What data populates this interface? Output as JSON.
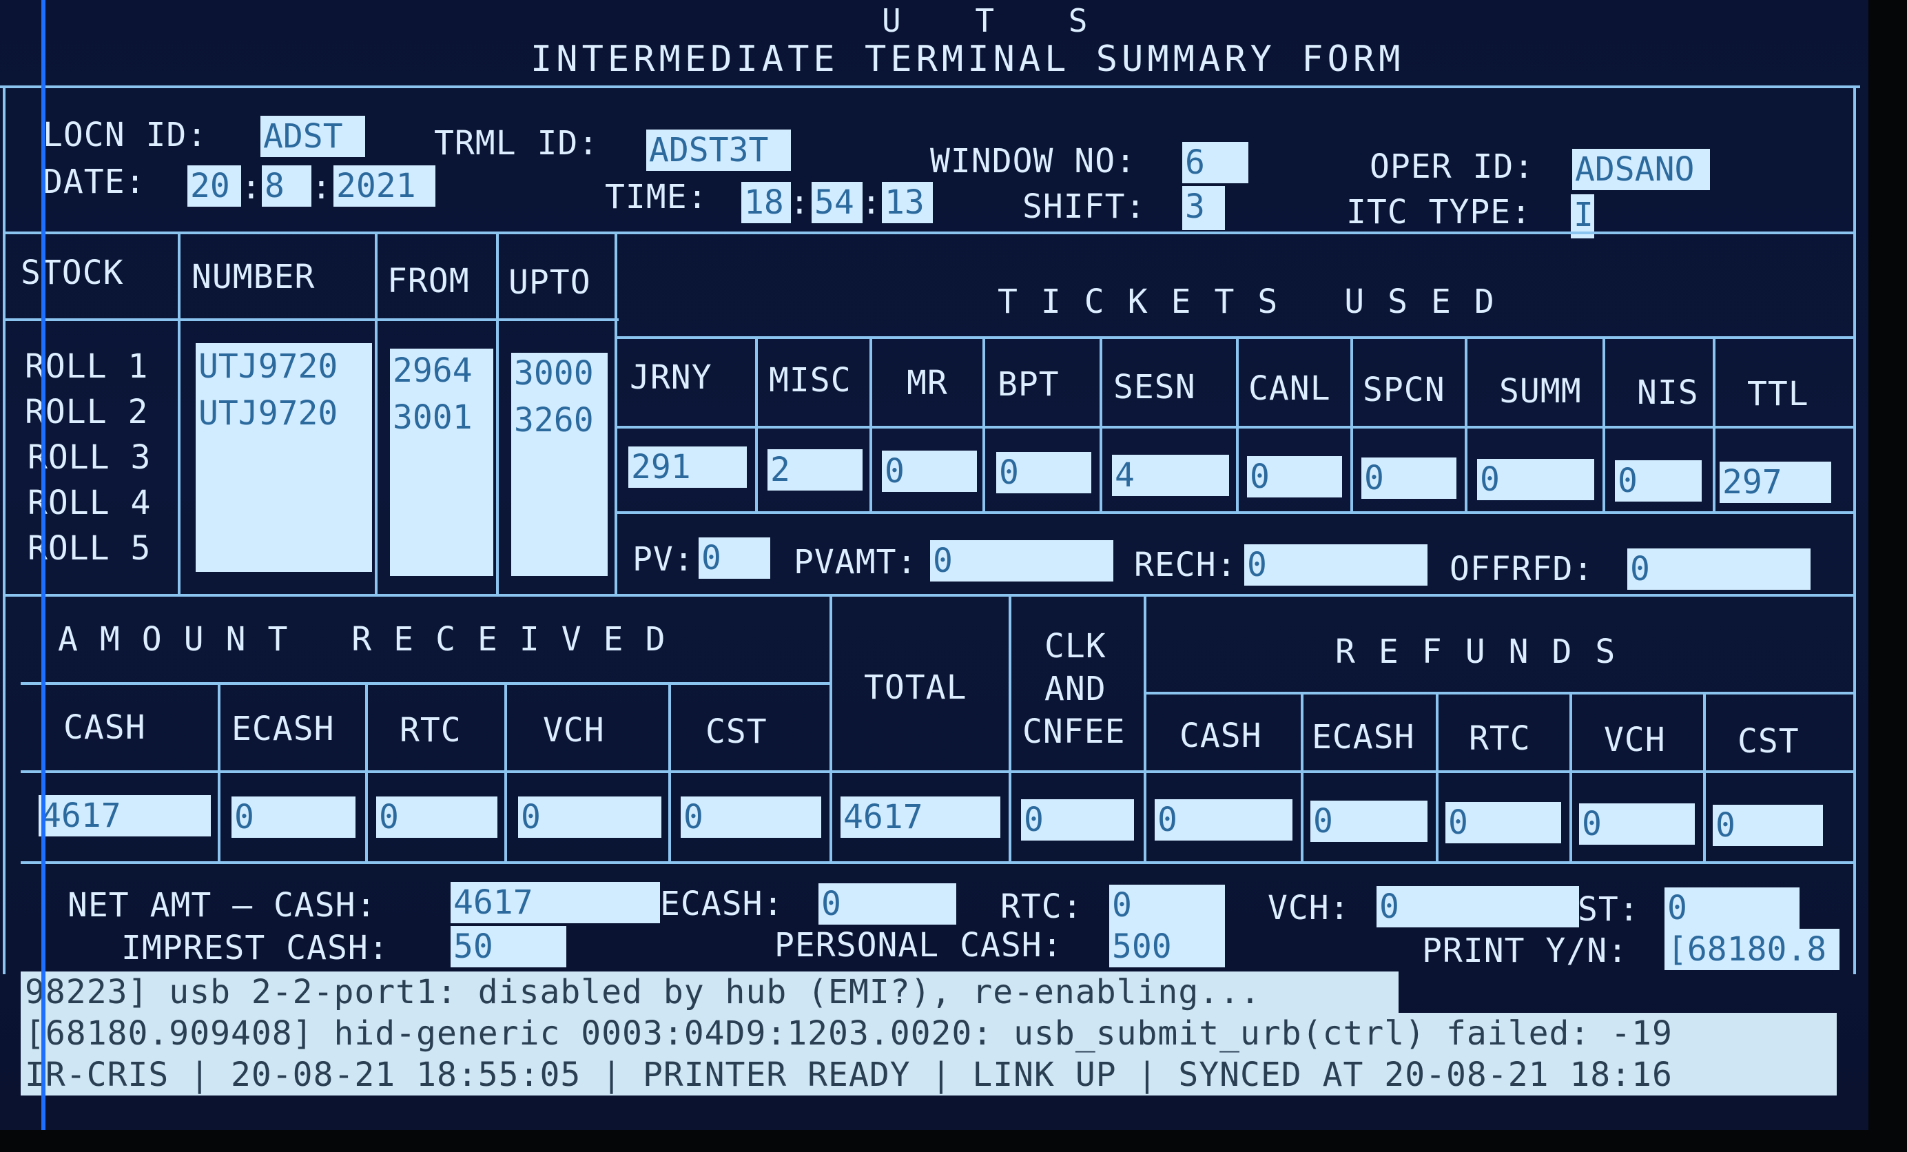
{
  "header": {
    "system": "U T S",
    "title": "INTERMEDIATE TERMINAL SUMMARY FORM"
  },
  "info": {
    "locn_label": "LOCN ID:",
    "locn_value": "ADST",
    "trml_label": "TRML ID:",
    "trml_value": "ADST3T",
    "window_label": "WINDOW NO:",
    "window_value": "6",
    "oper_label": "OPER ID:",
    "oper_value": "ADSANO",
    "date_label": "DATE:",
    "date_day": "20",
    "date_month": "8",
    "date_year": "2021",
    "date_sep": ":",
    "time_label": "TIME:",
    "time_h": "18",
    "time_m": "54",
    "time_s": "13",
    "shift_label": "SHIFT:",
    "shift_value": "3",
    "itc_label": "ITC TYPE:",
    "itc_value": "I"
  },
  "stock": {
    "headers": [
      "STOCK",
      "NUMBER",
      "FROM",
      "UPTO"
    ],
    "rolls": [
      {
        "label": "ROLL 1",
        "number": "UTJ9720",
        "from": "2964",
        "upto": "3000"
      },
      {
        "label": "ROLL 2",
        "number": "UTJ9720",
        "from": "3001",
        "upto": "3260"
      },
      {
        "label": "ROLL 3",
        "number": "",
        "from": "",
        "upto": ""
      },
      {
        "label": "ROLL 4",
        "number": "",
        "from": "",
        "upto": ""
      },
      {
        "label": "ROLL 5",
        "number": "",
        "from": "",
        "upto": ""
      }
    ]
  },
  "tickets": {
    "title": "TICKETS USED",
    "columns": [
      {
        "label": "JRNY",
        "value": "291"
      },
      {
        "label": "MISC",
        "value": "2"
      },
      {
        "label": "MR",
        "value": "0"
      },
      {
        "label": "BPT",
        "value": "0"
      },
      {
        "label": "SESN",
        "value": "4"
      },
      {
        "label": "CANL",
        "value": "0"
      },
      {
        "label": "SPCN",
        "value": "0"
      },
      {
        "label": "SUMM",
        "value": "0"
      },
      {
        "label": "NIS",
        "value": "0"
      },
      {
        "label": "TTL",
        "value": "297"
      }
    ],
    "pv_label": "PV:",
    "pv_value": "0",
    "pvamt_label": "PVAMT:",
    "pvamt_value": "0",
    "rech_label": "RECH:",
    "rech_value": "0",
    "offrfd_label": "OFFRFD:",
    "offrfd_value": "0"
  },
  "amount": {
    "title": "AMOUNT RECEIVED",
    "columns": [
      {
        "label": "CASH",
        "value": "4617"
      },
      {
        "label": "ECASH",
        "value": "0"
      },
      {
        "label": "RTC",
        "value": "0"
      },
      {
        "label": "VCH",
        "value": "0"
      },
      {
        "label": "CST",
        "value": "0"
      }
    ],
    "total_label": "TOTAL",
    "total_value": "4617",
    "clk_label_1": "CLK",
    "clk_label_2": "AND",
    "clk_label_3": "CNFEE",
    "clk_value": "0"
  },
  "refunds": {
    "title": "REFUNDS",
    "columns": [
      {
        "label": "CASH",
        "value": "0"
      },
      {
        "label": "ECASH",
        "value": "0"
      },
      {
        "label": "RTC",
        "value": "0"
      },
      {
        "label": "VCH",
        "value": "0"
      },
      {
        "label": "CST",
        "value": "0"
      }
    ]
  },
  "net": {
    "net_cash_label": "NET AMT — CASH:",
    "net_cash_value": "4617",
    "ecash_label": "ECASH:",
    "ecash_value": "0",
    "rtc_label": "RTC:",
    "rtc_value": "0",
    "vch_label": "VCH:",
    "vch_value": "0",
    "st_label": "ST:",
    "st_value": "0",
    "impress_label": "IMPREST CASH:",
    "impress_value": "50",
    "personal_label": "PERSONAL CASH:",
    "personal_value": "500",
    "print_label": "PRINT Y/N:",
    "print_value": "[68180.8"
  },
  "console": {
    "line1": "98223] usb 2-2-port1: disabled by hub (EMI?), re-enabling...",
    "line2": "[68180.909408] hid-generic 0003:04D9:1203.0020: usb_submit_urb(ctrl) failed: -19",
    "status": "IR-CRIS | 20-08-21 18:55:05 | PRINTER READY | LINK UP | SYNCED AT 20-08-21 18:16"
  }
}
